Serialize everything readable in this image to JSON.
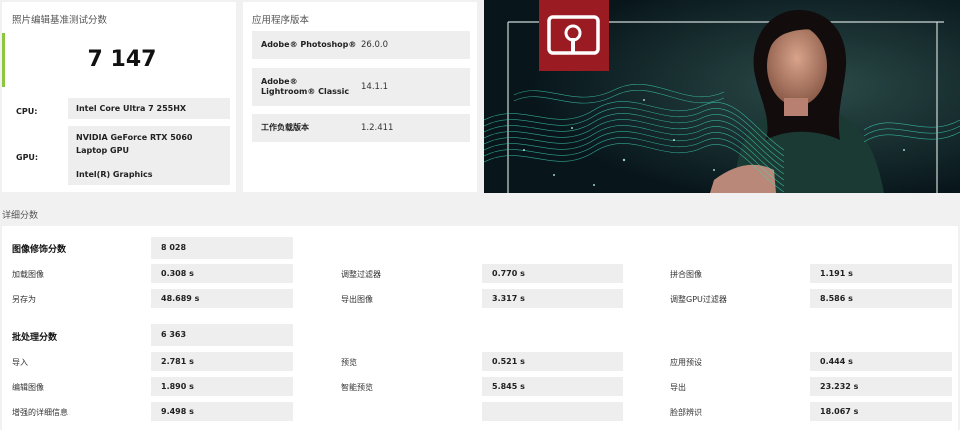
{
  "benchmark": {
    "title": "照片编辑基准测试分数",
    "score": "7 147",
    "cpu_label": "CPU:",
    "cpu_value": "Intel Core Ultra 7 255HX",
    "gpu_label": "GPU:",
    "gpu_value_1": "NVIDIA GeForce RTX 5060 Laptop GPU",
    "gpu_value_2": "Intel(R) Graphics",
    "accent_color": "#8cc63f"
  },
  "apps": {
    "title": "应用程序版本",
    "rows": [
      {
        "name": "Adobe® Photoshop®",
        "version": "26.0.0"
      },
      {
        "name": "Adobe® Lightroom® Classic",
        "version": "14.1.1"
      },
      {
        "name": "工作负载版本",
        "version": "1.2.411"
      }
    ]
  },
  "hero": {
    "logo_icon": "ul-procyon-logo-icon",
    "logo_color": "#9b1b22",
    "wave_color": "#3fd6b8"
  },
  "detail": {
    "title": "详细分数",
    "image_retouch": {
      "label": "图像修饰分数",
      "score": "8 028",
      "items": [
        {
          "label": "加载图像",
          "value": "0.308 s"
        },
        {
          "label": "调整过滤器",
          "value": "0.770 s"
        },
        {
          "label": "拼合图像",
          "value": "1.191 s"
        },
        {
          "label": "另存为",
          "value": "48.689 s"
        },
        {
          "label": "导出图像",
          "value": "3.317 s"
        },
        {
          "label": "调整GPU过滤器",
          "value": "8.586 s"
        }
      ]
    },
    "batch": {
      "label": "批处理分数",
      "score": "6 363",
      "items": [
        {
          "label": "导入",
          "value": "2.781 s"
        },
        {
          "label": "预览",
          "value": "0.521 s"
        },
        {
          "label": "应用预设",
          "value": "0.444 s"
        },
        {
          "label": "编辑图像",
          "value": "1.890 s"
        },
        {
          "label": "智能预览",
          "value": "5.845 s"
        },
        {
          "label": "导出",
          "value": "23.232 s"
        },
        {
          "label": "增强的详细信息",
          "value": "9.498 s"
        },
        {
          "label": "",
          "value": ""
        },
        {
          "label": "脸部辨识",
          "value": "18.067 s"
        }
      ]
    }
  }
}
